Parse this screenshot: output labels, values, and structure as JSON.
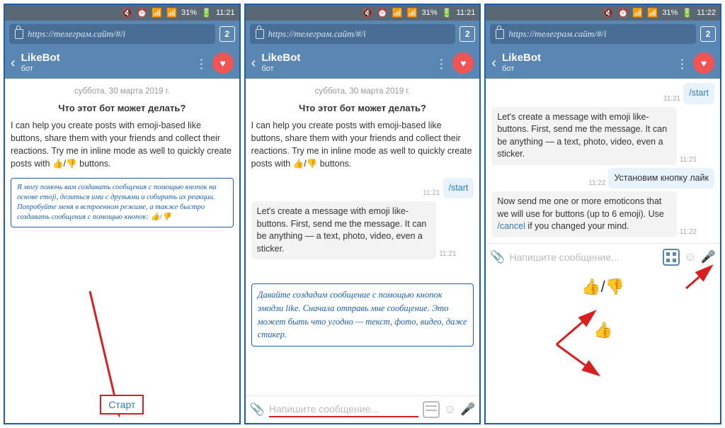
{
  "status": {
    "battery": "31%",
    "time1": "11:21",
    "time2": "11:22"
  },
  "browser": {
    "url": "https://телеграм.сайт/#/i",
    "tab_count": 2
  },
  "header": {
    "title": "LikeBot",
    "subtitle": "бот"
  },
  "chat": {
    "date": "суббота, 30 марта 2019 г.",
    "intro_title": "Что этот бот может делать?",
    "intro_text": "I can help you create posts with emoji-based like buttons, share them with your friends and collect their reactions. Try me in inline mode as well to quickly create posts with 👍/👎 buttons.",
    "translation1": "Я могу помочь вам создавать сообщения с помощью кнопок на основе emoji, делиться ими с друзьями и собирать их реакции. Попробуйте меня в встроенном режиме, а также быстро создавать сообщения с помощью кнопок: 👍/👎",
    "start_btn": "Старт",
    "cmd_start": "/start",
    "msg_create": "Let's create a message with emoji like-buttons. First, send me the message. It can be anything — a text, photo, video, even a sticker.",
    "translation2": "Давайте создадим сообщение с помощью кнопок эмодзи like. Сначала отправь мне сообщение. Это может быть что угодно — текст, фото, видео, даже стикер.",
    "input_placeholder": "Напишите сообщение...",
    "msg_set_like": "Установим кнопку лайк",
    "msg_send_emoji_pre": "Now send me one or more emoticons that we will use for buttons (up to 6 emoji). Use ",
    "msg_cancel_cmd": "/cancel",
    "msg_send_emoji_post": " if you changed your mind.",
    "t1121": "11:21",
    "t1122": "11:22",
    "sticker1": "👍/👎",
    "sticker2": "👍"
  }
}
